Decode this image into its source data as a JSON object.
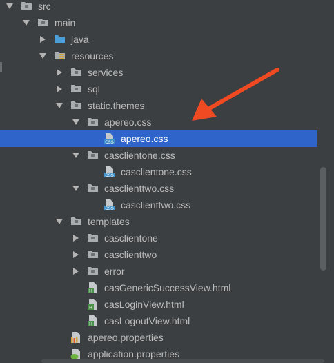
{
  "tree": [
    {
      "label": "src",
      "depth": 0,
      "icon": "folder-gray",
      "arrow": "down"
    },
    {
      "label": "main",
      "depth": 1,
      "icon": "folder-gray",
      "arrow": "down"
    },
    {
      "label": "java",
      "depth": 2,
      "icon": "folder-blue",
      "arrow": "right"
    },
    {
      "label": "resources",
      "depth": 2,
      "icon": "resources-folder",
      "arrow": "down"
    },
    {
      "label": "services",
      "depth": 3,
      "icon": "folder-gray",
      "arrow": "right"
    },
    {
      "label": "sql",
      "depth": 3,
      "icon": "folder-gray",
      "arrow": "right"
    },
    {
      "label": "static.themes",
      "depth": 3,
      "icon": "folder-gray",
      "arrow": "down"
    },
    {
      "label": "apereo.css",
      "depth": 4,
      "icon": "folder-gray",
      "arrow": "down"
    },
    {
      "label": "apereo.css",
      "depth": 5,
      "icon": "css-file",
      "arrow": "none",
      "selected": true
    },
    {
      "label": "casclientone.css",
      "depth": 4,
      "icon": "folder-gray",
      "arrow": "down"
    },
    {
      "label": "casclientone.css",
      "depth": 5,
      "icon": "css-file",
      "arrow": "none"
    },
    {
      "label": "casclienttwo.css",
      "depth": 4,
      "icon": "folder-gray",
      "arrow": "down"
    },
    {
      "label": "casclienttwo.css",
      "depth": 5,
      "icon": "css-file",
      "arrow": "none"
    },
    {
      "label": "templates",
      "depth": 3,
      "icon": "folder-gray",
      "arrow": "down"
    },
    {
      "label": "casclientone",
      "depth": 4,
      "icon": "folder-gray",
      "arrow": "right"
    },
    {
      "label": "casclienttwo",
      "depth": 4,
      "icon": "folder-gray",
      "arrow": "right"
    },
    {
      "label": "error",
      "depth": 4,
      "icon": "folder-gray",
      "arrow": "right"
    },
    {
      "label": "casGenericSuccessView.html",
      "depth": 4,
      "icon": "html-file",
      "arrow": "none"
    },
    {
      "label": "casLoginView.html",
      "depth": 4,
      "icon": "html-file",
      "arrow": "none"
    },
    {
      "label": "casLogoutView.html",
      "depth": 4,
      "icon": "html-file",
      "arrow": "none"
    },
    {
      "label": "apereo.properties",
      "depth": 3,
      "icon": "properties-file",
      "arrow": "none"
    },
    {
      "label": "application.properties",
      "depth": 3,
      "icon": "spring-properties-file",
      "arrow": "none"
    }
  ],
  "icons": {
    "folder-gray": "folder-icon",
    "folder-blue": "source-folder-icon",
    "resources-folder": "resources-folder-icon",
    "css-file": "css-file-icon",
    "html-file": "html-file-icon",
    "properties-file": "properties-file-icon",
    "spring-properties-file": "spring-properties-icon"
  },
  "colors": {
    "background": "#3c3f41",
    "selection": "#2f65ca",
    "text": "#bbbbbb",
    "annotation": "#f04a23"
  }
}
